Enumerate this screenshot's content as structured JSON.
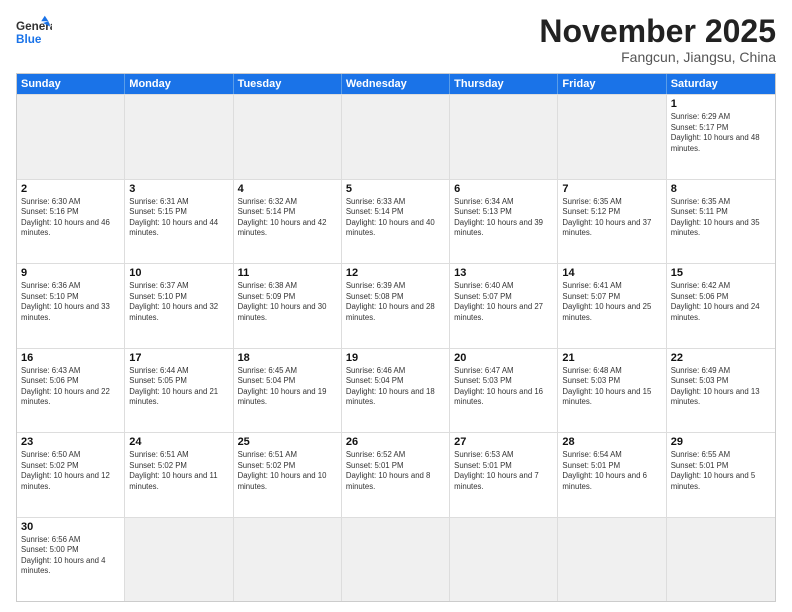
{
  "header": {
    "logo_general": "General",
    "logo_blue": "Blue",
    "month_title": "November 2025",
    "location": "Fangcun, Jiangsu, China"
  },
  "days_of_week": [
    "Sunday",
    "Monday",
    "Tuesday",
    "Wednesday",
    "Thursday",
    "Friday",
    "Saturday"
  ],
  "weeks": [
    [
      {
        "day": "",
        "empty": true
      },
      {
        "day": "",
        "empty": true
      },
      {
        "day": "",
        "empty": true
      },
      {
        "day": "",
        "empty": true
      },
      {
        "day": "",
        "empty": true
      },
      {
        "day": "",
        "empty": true
      },
      {
        "day": "1",
        "sunrise": "6:29 AM",
        "sunset": "5:17 PM",
        "daylight": "10 hours and 48 minutes."
      }
    ],
    [
      {
        "day": "2",
        "sunrise": "6:30 AM",
        "sunset": "5:16 PM",
        "daylight": "10 hours and 46 minutes."
      },
      {
        "day": "3",
        "sunrise": "6:31 AM",
        "sunset": "5:15 PM",
        "daylight": "10 hours and 44 minutes."
      },
      {
        "day": "4",
        "sunrise": "6:32 AM",
        "sunset": "5:14 PM",
        "daylight": "10 hours and 42 minutes."
      },
      {
        "day": "5",
        "sunrise": "6:33 AM",
        "sunset": "5:14 PM",
        "daylight": "10 hours and 40 minutes."
      },
      {
        "day": "6",
        "sunrise": "6:34 AM",
        "sunset": "5:13 PM",
        "daylight": "10 hours and 39 minutes."
      },
      {
        "day": "7",
        "sunrise": "6:35 AM",
        "sunset": "5:12 PM",
        "daylight": "10 hours and 37 minutes."
      },
      {
        "day": "8",
        "sunrise": "6:35 AM",
        "sunset": "5:11 PM",
        "daylight": "10 hours and 35 minutes."
      }
    ],
    [
      {
        "day": "9",
        "sunrise": "6:36 AM",
        "sunset": "5:10 PM",
        "daylight": "10 hours and 33 minutes."
      },
      {
        "day": "10",
        "sunrise": "6:37 AM",
        "sunset": "5:10 PM",
        "daylight": "10 hours and 32 minutes."
      },
      {
        "day": "11",
        "sunrise": "6:38 AM",
        "sunset": "5:09 PM",
        "daylight": "10 hours and 30 minutes."
      },
      {
        "day": "12",
        "sunrise": "6:39 AM",
        "sunset": "5:08 PM",
        "daylight": "10 hours and 28 minutes."
      },
      {
        "day": "13",
        "sunrise": "6:40 AM",
        "sunset": "5:07 PM",
        "daylight": "10 hours and 27 minutes."
      },
      {
        "day": "14",
        "sunrise": "6:41 AM",
        "sunset": "5:07 PM",
        "daylight": "10 hours and 25 minutes."
      },
      {
        "day": "15",
        "sunrise": "6:42 AM",
        "sunset": "5:06 PM",
        "daylight": "10 hours and 24 minutes."
      }
    ],
    [
      {
        "day": "16",
        "sunrise": "6:43 AM",
        "sunset": "5:06 PM",
        "daylight": "10 hours and 22 minutes."
      },
      {
        "day": "17",
        "sunrise": "6:44 AM",
        "sunset": "5:05 PM",
        "daylight": "10 hours and 21 minutes."
      },
      {
        "day": "18",
        "sunrise": "6:45 AM",
        "sunset": "5:04 PM",
        "daylight": "10 hours and 19 minutes."
      },
      {
        "day": "19",
        "sunrise": "6:46 AM",
        "sunset": "5:04 PM",
        "daylight": "10 hours and 18 minutes."
      },
      {
        "day": "20",
        "sunrise": "6:47 AM",
        "sunset": "5:03 PM",
        "daylight": "10 hours and 16 minutes."
      },
      {
        "day": "21",
        "sunrise": "6:48 AM",
        "sunset": "5:03 PM",
        "daylight": "10 hours and 15 minutes."
      },
      {
        "day": "22",
        "sunrise": "6:49 AM",
        "sunset": "5:03 PM",
        "daylight": "10 hours and 13 minutes."
      }
    ],
    [
      {
        "day": "23",
        "sunrise": "6:50 AM",
        "sunset": "5:02 PM",
        "daylight": "10 hours and 12 minutes."
      },
      {
        "day": "24",
        "sunrise": "6:51 AM",
        "sunset": "5:02 PM",
        "daylight": "10 hours and 11 minutes."
      },
      {
        "day": "25",
        "sunrise": "6:51 AM",
        "sunset": "5:02 PM",
        "daylight": "10 hours and 10 minutes."
      },
      {
        "day": "26",
        "sunrise": "6:52 AM",
        "sunset": "5:01 PM",
        "daylight": "10 hours and 8 minutes."
      },
      {
        "day": "27",
        "sunrise": "6:53 AM",
        "sunset": "5:01 PM",
        "daylight": "10 hours and 7 minutes."
      },
      {
        "day": "28",
        "sunrise": "6:54 AM",
        "sunset": "5:01 PM",
        "daylight": "10 hours and 6 minutes."
      },
      {
        "day": "29",
        "sunrise": "6:55 AM",
        "sunset": "5:01 PM",
        "daylight": "10 hours and 5 minutes."
      }
    ],
    [
      {
        "day": "30",
        "sunrise": "6:56 AM",
        "sunset": "5:00 PM",
        "daylight": "10 hours and 4 minutes."
      },
      {
        "day": "",
        "empty": true
      },
      {
        "day": "",
        "empty": true
      },
      {
        "day": "",
        "empty": true
      },
      {
        "day": "",
        "empty": true
      },
      {
        "day": "",
        "empty": true
      },
      {
        "day": "",
        "empty": true
      }
    ]
  ]
}
